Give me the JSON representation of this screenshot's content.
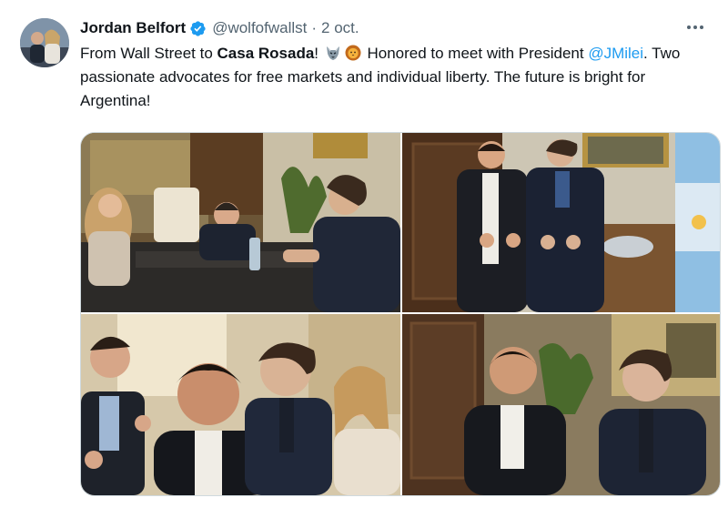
{
  "tweet": {
    "author_name": "Jordan Belfort",
    "handle": "@wolfofwallst",
    "separator": "·",
    "date": "2 oct.",
    "text_part1": "From Wall Street to ",
    "text_bold": "Casa Rosada",
    "text_part2": "! ",
    "text_part3": " Honored to meet with President ",
    "mention": "@JMilei",
    "text_part4": ". Two passionate advocates for free markets and individual liberty. The future is bright for Argentina!",
    "emojis": [
      "wolf-emoji",
      "lion-emoji"
    ],
    "verified_color": "#1d9bf0",
    "mention_color": "#1d9bf0",
    "photos": [
      {
        "name": "photo-meeting-table"
      },
      {
        "name": "photo-standing-thumbs-up"
      },
      {
        "name": "photo-group-selfie"
      },
      {
        "name": "photo-seated-portrait"
      }
    ]
  }
}
